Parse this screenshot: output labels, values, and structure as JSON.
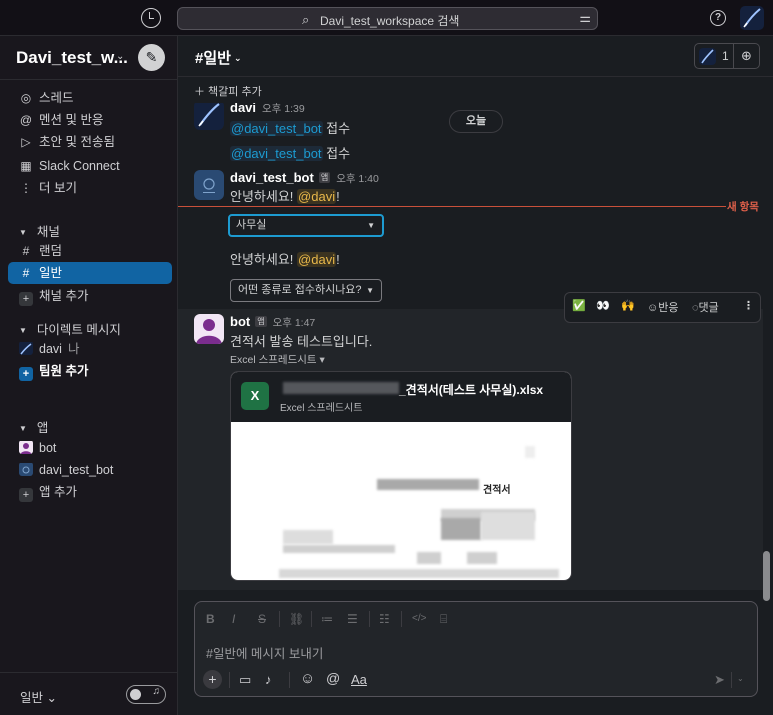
{
  "topbar": {
    "search_text": "Davi_test_workspace 검색",
    "search_icon": "magnifier-icon",
    "filter_icon": "sliders-icon",
    "help_label": "?"
  },
  "sidebar": {
    "workspace_name": "Davi_test_w...",
    "workspace_chevron": "⌄",
    "compose_icon": "✎",
    "top_items": [
      {
        "label": "스레드",
        "icon": "thread-icon",
        "glyph": "◎"
      },
      {
        "label": "멘션 및 반응",
        "icon": "at-icon",
        "glyph": "@"
      },
      {
        "label": "초안 및 전송됨",
        "icon": "send-icon",
        "glyph": "▷"
      },
      {
        "label": "Slack Connect",
        "icon": "building-icon",
        "glyph": "▦"
      },
      {
        "label": "더 보기",
        "icon": "more-icon",
        "glyph": "⋮"
      }
    ],
    "channels_header": "채널",
    "channels": [
      {
        "label": "랜덤",
        "glyph": "#"
      },
      {
        "label": "일반",
        "glyph": "#"
      }
    ],
    "add_channel": "채널 추가",
    "dm_header": "다이렉트 메시지",
    "dm_user": "davi",
    "dm_me_tag": "나",
    "add_teammate": "팀원 추가",
    "apps_header": "앱",
    "apps": [
      {
        "label": "bot"
      },
      {
        "label": "davi_test_bot"
      }
    ],
    "add_app": "앱 추가",
    "status_channel": "일반",
    "status_chevron": "⌄",
    "headphone_icon": "🎧"
  },
  "channel": {
    "hash": "#",
    "name": "일반",
    "chevron": "⌄",
    "member_count": "1",
    "add_member_icon": "👤+",
    "bookmark_add": "＋ 책갈피 추가"
  },
  "messages": {
    "date_pill": "오늘",
    "m1": {
      "user": "davi",
      "time": "오후 1:39",
      "mention": "@davi_test_bot",
      "suffix": " 접수"
    },
    "m1b": {
      "mention": "@davi_test_bot",
      "suffix": " 접수"
    },
    "m2": {
      "user": "davi_test_bot",
      "app_tag": "앱",
      "time": "오후 1:40",
      "prefix": "안녕하세요! ",
      "mention": "@davi",
      "suffix": "!"
    },
    "new_label": "새 항목",
    "select1": "사무실",
    "m2b": {
      "prefix": "안녕하세요! ",
      "mention": "@davi",
      "suffix": "!"
    },
    "select2": "어떤 종류로 접수하시나요?",
    "m3": {
      "user": "bot",
      "app_tag": "앱",
      "time": "오후 1:47",
      "text": "견적서 발송 테스트입니다."
    },
    "file_label": "Excel 스프레드시트 ▾",
    "file": {
      "icon_letter": "X",
      "name": "_견적서(테스트 사무실).xlsx",
      "type": "Excel 스프레드시트",
      "preview_title": "견적서"
    },
    "toolbar": {
      "check": "✅",
      "eyes": "👀",
      "hands": "🙌",
      "react_label": "반응",
      "react_icon": "smile-plus-icon",
      "reply_label": "댓글",
      "reply_icon": "comment-icon",
      "more": "⋮"
    }
  },
  "composer": {
    "placeholder": "#일반에 메시지 보내기",
    "format": {
      "bold": "B",
      "italic": "I",
      "strike": "S",
      "link": "🔗",
      "ol": "≔",
      "ul": "☰",
      "quote": "☷",
      "code": "</>",
      "codeblock": "⌸"
    },
    "tools": {
      "plus": "+",
      "video": "▭",
      "mic": "🎙",
      "emoji": "☺",
      "mention": "@",
      "aa": "Aa"
    },
    "send": "➤",
    "send_opts": "⌄"
  },
  "colors": {
    "accent": "#1164a3",
    "new_line": "#c9503a",
    "mention": "#e8b84a",
    "excel": "#1f7244"
  }
}
